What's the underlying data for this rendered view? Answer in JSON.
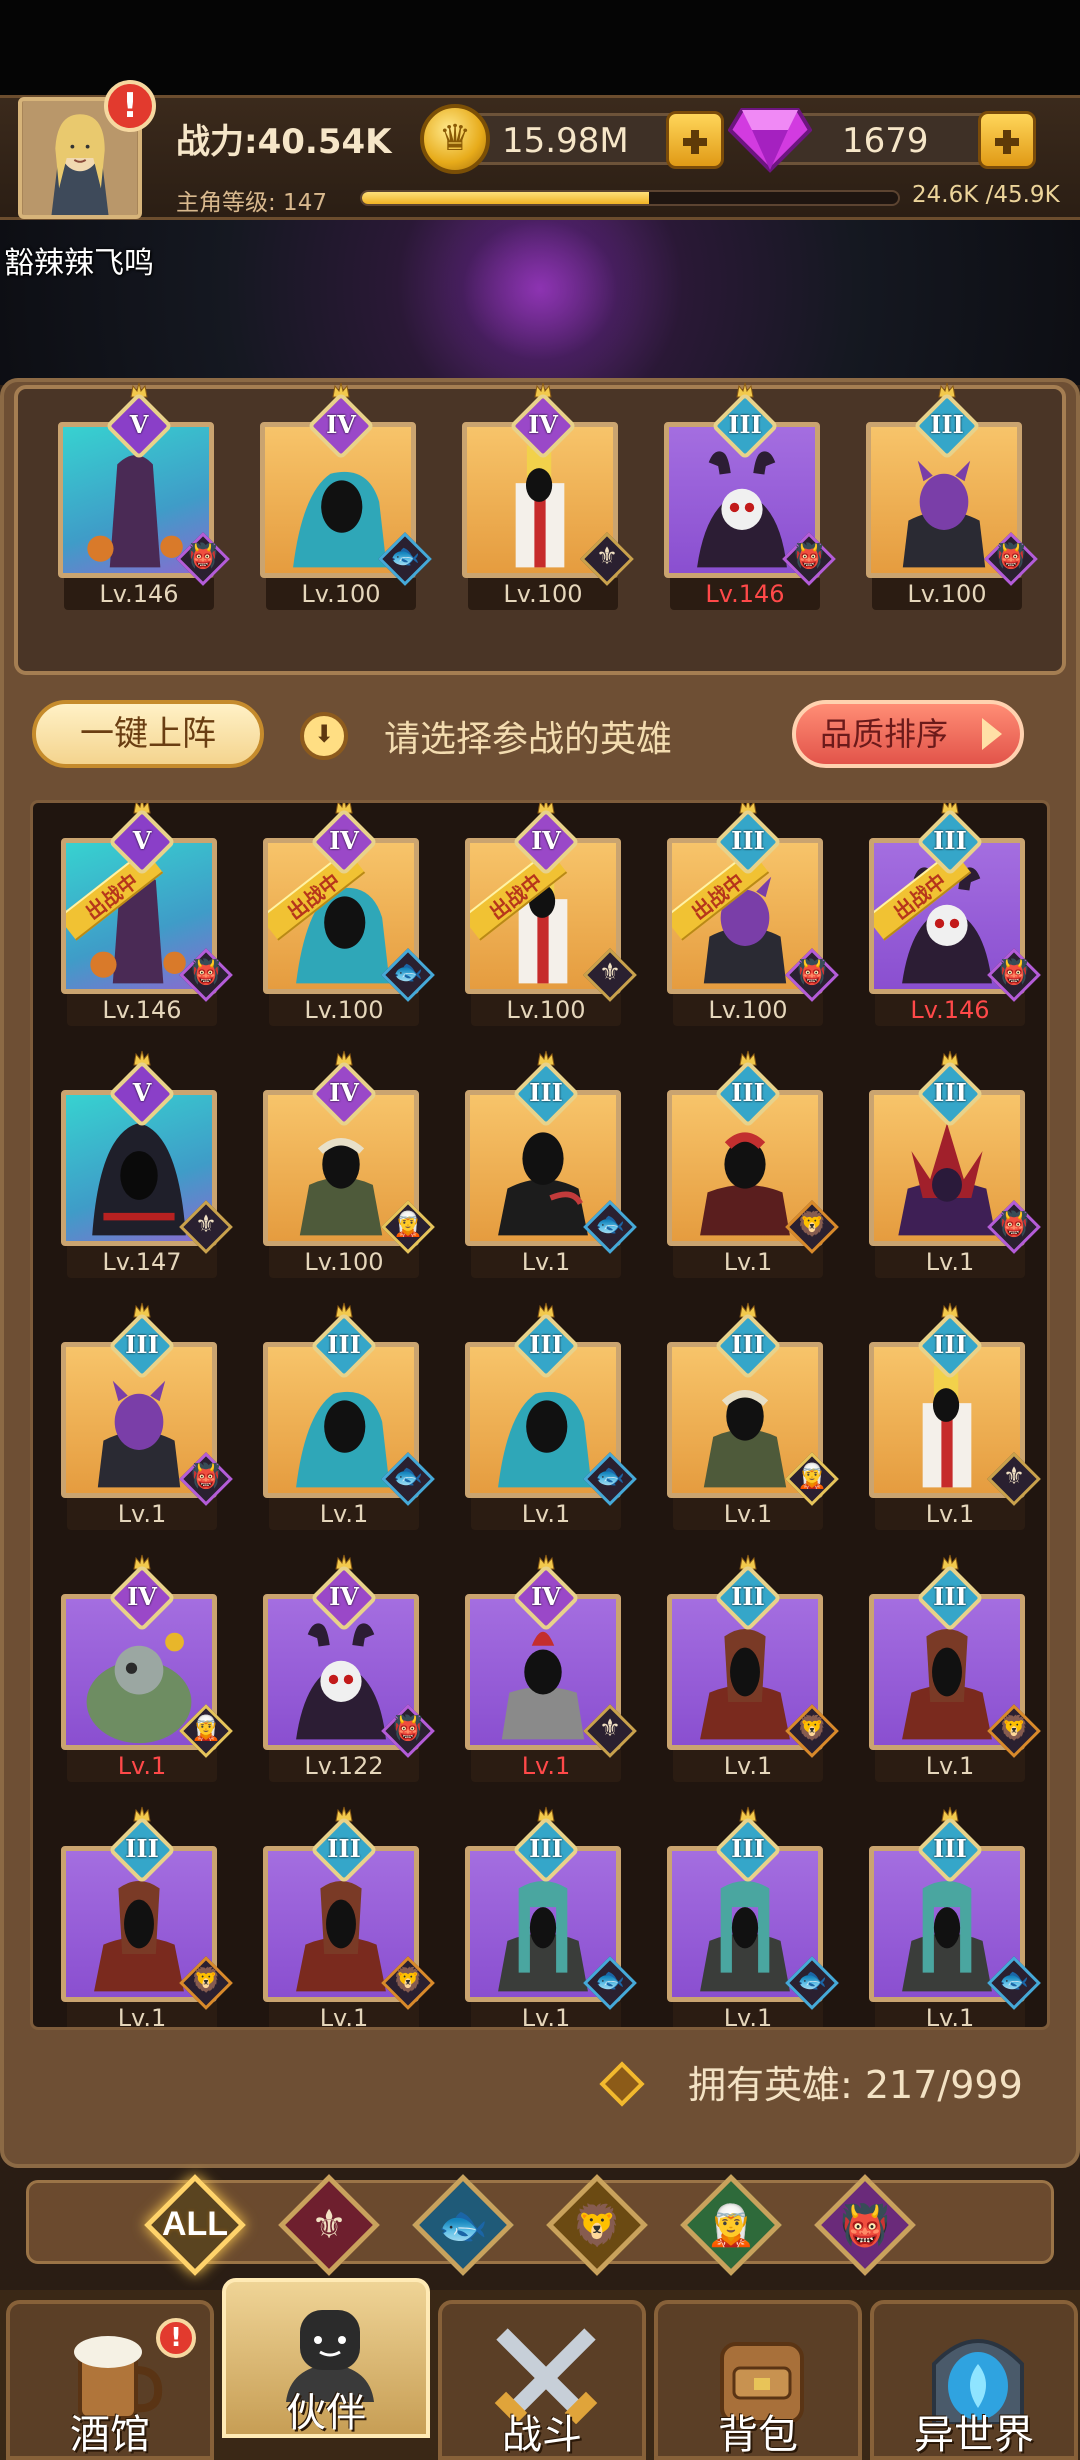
{
  "player": {
    "power": "战力:40.54K",
    "gold": "15.98M",
    "gems": "1679",
    "level_label": "主角等级: 147",
    "exp_text": "24.6K /45.9K",
    "exp_progress": 0.536,
    "name": "豁辣辣飞鸣",
    "alert": "!"
  },
  "controls": {
    "one_click": "一键上阵",
    "hint": "请选择参战的英雄",
    "sort": "品质排序"
  },
  "in_battle_label": "出战中",
  "team": [
    {
      "rank": "V",
      "level": "Lv.146",
      "red": false,
      "bg": "teal",
      "art": "tree",
      "faction": "orc"
    },
    {
      "rank": "IV",
      "level": "Lv.100",
      "red": false,
      "bg": "gold",
      "art": "naga",
      "faction": "beast"
    },
    {
      "rank": "IV",
      "level": "Lv.100",
      "red": false,
      "bg": "gold",
      "art": "priest",
      "faction": "human"
    },
    {
      "rank": "III",
      "level": "Lv.146",
      "red": true,
      "bg": "purple",
      "art": "skull",
      "faction": "orc"
    },
    {
      "rank": "III",
      "level": "Lv.100",
      "red": false,
      "bg": "gold",
      "art": "demon",
      "faction": "orc"
    }
  ],
  "heroes": [
    {
      "rank": "V",
      "level": "Lv.146",
      "red": false,
      "bg": "teal",
      "art": "tree",
      "faction": "orc",
      "in_battle": true
    },
    {
      "rank": "IV",
      "level": "Lv.100",
      "red": false,
      "bg": "gold",
      "art": "naga",
      "faction": "beast",
      "in_battle": true
    },
    {
      "rank": "IV",
      "level": "Lv.100",
      "red": false,
      "bg": "gold",
      "art": "priest",
      "faction": "human",
      "in_battle": true
    },
    {
      "rank": "III",
      "level": "Lv.100",
      "red": false,
      "bg": "gold",
      "art": "demon",
      "faction": "orc",
      "in_battle": true
    },
    {
      "rank": "III",
      "level": "Lv.146",
      "red": true,
      "bg": "purple",
      "art": "skull",
      "faction": "orc",
      "in_battle": true
    },
    {
      "rank": "V",
      "level": "Lv.147",
      "red": false,
      "bg": "teal",
      "art": "hood",
      "faction": "human",
      "in_battle": false
    },
    {
      "rank": "IV",
      "level": "Lv.100",
      "red": false,
      "bg": "gold",
      "art": "elf",
      "faction": "elf",
      "in_battle": false
    },
    {
      "rank": "III",
      "level": "Lv.1",
      "red": false,
      "bg": "gold",
      "art": "rogue",
      "faction": "beast",
      "in_battle": false
    },
    {
      "rank": "III",
      "level": "Lv.1",
      "red": false,
      "bg": "gold",
      "art": "warrior",
      "faction": "lion",
      "in_battle": false
    },
    {
      "rank": "III",
      "level": "Lv.1",
      "red": false,
      "bg": "gold",
      "art": "spiky",
      "faction": "orc",
      "in_battle": false
    },
    {
      "rank": "III",
      "level": "Lv.1",
      "red": false,
      "bg": "gold",
      "art": "demon",
      "faction": "orc",
      "in_battle": false
    },
    {
      "rank": "III",
      "level": "Lv.1",
      "red": false,
      "bg": "gold",
      "art": "naga",
      "faction": "beast",
      "in_battle": false
    },
    {
      "rank": "III",
      "level": "Lv.1",
      "red": false,
      "bg": "gold",
      "art": "naga",
      "faction": "beast",
      "in_battle": false
    },
    {
      "rank": "III",
      "level": "Lv.1",
      "red": false,
      "bg": "gold",
      "art": "elf",
      "faction": "elf",
      "in_battle": false
    },
    {
      "rank": "III",
      "level": "Lv.1",
      "red": false,
      "bg": "gold",
      "art": "priest",
      "faction": "human",
      "in_battle": false
    },
    {
      "rank": "IV",
      "level": "Lv.1",
      "red": true,
      "bg": "purple",
      "art": "golem",
      "faction": "elf",
      "in_battle": false
    },
    {
      "rank": "IV",
      "level": "Lv.122",
      "red": false,
      "bg": "purple",
      "art": "skull",
      "faction": "orc",
      "in_battle": false
    },
    {
      "rank": "IV",
      "level": "Lv.1",
      "red": true,
      "bg": "purple",
      "art": "knight",
      "faction": "human",
      "in_battle": false
    },
    {
      "rank": "III",
      "level": "Lv.1",
      "red": false,
      "bg": "purple",
      "art": "horse",
      "faction": "lion",
      "in_battle": false
    },
    {
      "rank": "III",
      "level": "Lv.1",
      "red": false,
      "bg": "purple",
      "art": "horse",
      "faction": "lion",
      "in_battle": false
    },
    {
      "rank": "III",
      "level": "Lv.1",
      "red": false,
      "bg": "purple",
      "art": "horse",
      "faction": "lion",
      "in_battle": false
    },
    {
      "rank": "III",
      "level": "Lv.1",
      "red": false,
      "bg": "purple",
      "art": "horse",
      "faction": "lion",
      "in_battle": false
    },
    {
      "rank": "III",
      "level": "Lv.1",
      "red": false,
      "bg": "purple",
      "art": "sage",
      "faction": "beast",
      "in_battle": false
    },
    {
      "rank": "III",
      "level": "Lv.1",
      "red": false,
      "bg": "purple",
      "art": "sage",
      "faction": "beast",
      "in_battle": false
    },
    {
      "rank": "III",
      "level": "Lv.1",
      "red": false,
      "bg": "purple",
      "art": "sage",
      "faction": "beast",
      "in_battle": false
    }
  ],
  "owned": "拥有英雄: 217/999",
  "filters": [
    {
      "label": "ALL",
      "icon": "all-filter-icon",
      "active": true
    },
    {
      "label": "",
      "icon": "human-faction-icon",
      "active": false
    },
    {
      "label": "",
      "icon": "beast-faction-icon",
      "active": false
    },
    {
      "label": "",
      "icon": "lion-faction-icon",
      "active": false
    },
    {
      "label": "",
      "icon": "elf-faction-icon",
      "active": false
    },
    {
      "label": "",
      "icon": "orc-faction-icon",
      "active": false
    }
  ],
  "nav": [
    {
      "label": "酒馆",
      "icon": "tavern-icon",
      "active": false,
      "alert": true
    },
    {
      "label": "伙伴",
      "icon": "partner-icon",
      "active": true,
      "alert": false
    },
    {
      "label": "战斗",
      "icon": "battle-icon",
      "active": false,
      "alert": false
    },
    {
      "label": "背包",
      "icon": "backpack-icon",
      "active": false,
      "alert": false
    },
    {
      "label": "异世界",
      "icon": "portal-icon",
      "active": false,
      "alert": false
    }
  ],
  "colors": {
    "bg_teal": "#2fc7c9",
    "bg_gold": "#f2b75a",
    "bg_purple": "#9a63d6",
    "rank_V": "#8a3fc8",
    "rank_IV": "#9a48c8",
    "rank_III": "#35a6c9",
    "accent_gold": "#f0b324",
    "level_red": "#ff4949"
  }
}
